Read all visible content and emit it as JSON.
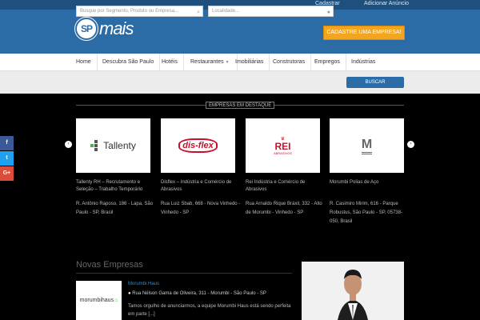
{
  "topbar": {
    "cadastrar": "Cadastrar",
    "adicionar": "Adicionar Anúncio"
  },
  "header": {
    "logo_sp": "SP",
    "logo_word": "mais",
    "cta": "CADASTRE UMA EMPRESA!"
  },
  "nav": {
    "items": [
      "Home",
      "Descubra São Paulo",
      "Hotéis",
      "Restaurantes",
      "Imobiliárias",
      "Construtoras",
      "Empregos",
      "Indústrias"
    ]
  },
  "search": {
    "placeholder_business": "Busque por Segmento, Produto ou Empresa...",
    "placeholder_location": "Localidade...",
    "button": "BUSCAR"
  },
  "featured": {
    "title": "EMPRESAS EM DESTAQUE",
    "cards": [
      {
        "logo_text": "Tallenty",
        "name": "Tallenty RH – Recrutamento e Seleção – Trabalho Temporário",
        "address": "R. Antônio Raposo, 186 - Lapa, São Paulo - SP, Brasil"
      },
      {
        "logo_text": "dis-flex",
        "name": "Disflex – Indústria e Comércio de Abrasivos",
        "address": "Rua Luiz Sbab, 668 - Nova Vinhedo - Vinhedo - SP"
      },
      {
        "logo_text": "REI",
        "logo_sub": "ABRASIVOS",
        "name": "Rei Indústria e Comércio de Abrasivos",
        "address": "Rua Arnaldo Rique Bráxil, 332 - Alto de Morumbi - Vinhedo - SP"
      },
      {
        "logo_text": "M",
        "name": "Morumbi Polias de Aço",
        "address": "R. Casimiro Mirim, 616 - Parque Robustus, São Paulo - SP, 05738-050, Brasil"
      }
    ]
  },
  "social": [
    {
      "label": "f",
      "icon": "facebook-icon",
      "color": "#3b5998"
    },
    {
      "label": "t",
      "icon": "twitter-icon",
      "color": "#1da1f2"
    },
    {
      "label": "G+",
      "icon": "google-plus-icon",
      "color": "#dd4b39"
    }
  ],
  "news": {
    "title": "Novas Empresas",
    "item": {
      "logo_text": "morumbihaus",
      "name": "Morumbi Haus",
      "address": "Rua Nélson Gama de Oliveira, 311 - Morumbi - São Paulo - SP",
      "description": "Tamos orgulho de anunciarmos, a equipe Morumbi Haus está sendo perfeita em parte [...]"
    }
  }
}
